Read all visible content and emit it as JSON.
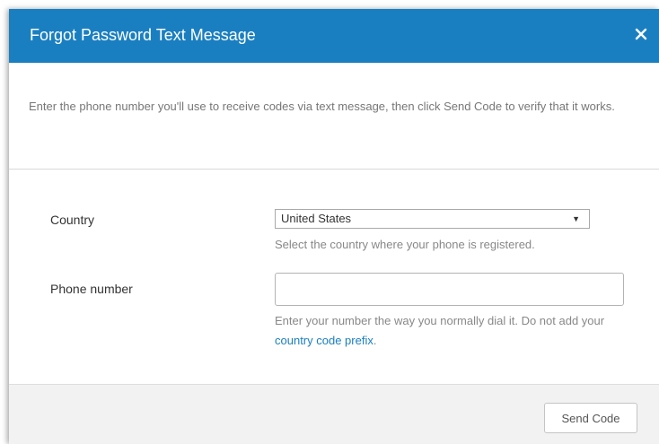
{
  "dialog": {
    "title": "Forgot Password Text Message",
    "close_icon": "close-icon",
    "intro_text": "Enter the phone number you'll use to receive codes via text message, then click Send Code to verify that it works."
  },
  "form": {
    "country": {
      "label": "Country",
      "selected_value": "United States",
      "arrow_glyph": "▼",
      "help_text": "Select the country where your phone is registered."
    },
    "phone": {
      "label": "Phone number",
      "value": "",
      "help_text_before": "Enter your number the way you normally dial it. Do not add your ",
      "help_link": "country code prefix",
      "help_text_after": "."
    }
  },
  "footer": {
    "send_button_label": "Send Code"
  },
  "colors": {
    "header_bg": "#1a7fc1",
    "link": "#1a7fc1",
    "footer_bg": "#f2f2f2"
  }
}
